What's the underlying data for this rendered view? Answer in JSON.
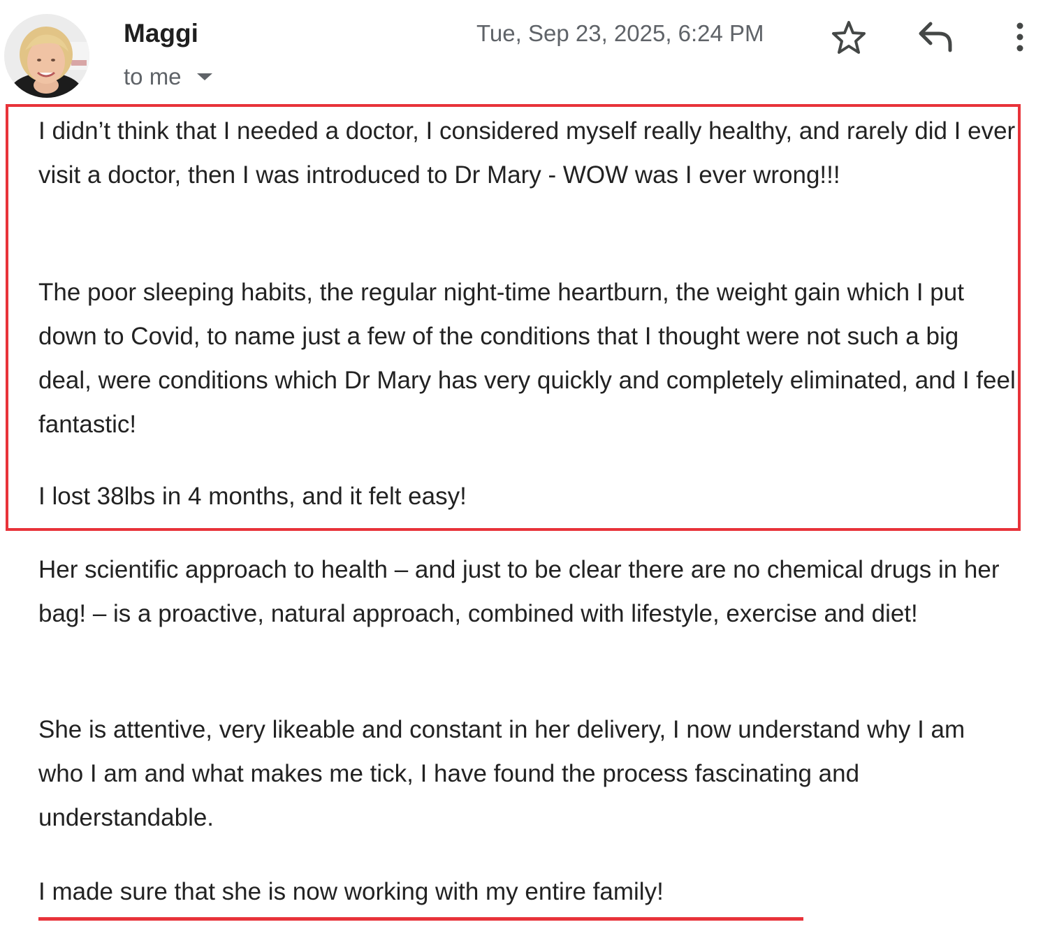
{
  "header": {
    "sender_name": "Maggi",
    "recipient_label": "to me",
    "timestamp": "Tue, Sep 23, 2025, 6:24 PM",
    "icons": {
      "star": "star-icon",
      "reply": "reply-icon",
      "more": "more-vertical-icon",
      "recipient_dropdown": "caret-down-icon"
    }
  },
  "message": {
    "paragraphs": [
      "I didn’t think that I needed a doctor, I considered myself really healthy, and rarely did I ever visit a doctor, then I was introduced to Dr Mary - WOW was I ever wrong!!!",
      "The poor sleeping habits, the regular night-time heartburn, the weight gain which I put down to Covid, to name just a few of the conditions that I thought were not such a big deal, were conditions which Dr Mary has very quickly and completely eliminated, and I feel fantastic!",
      "I lost 38lbs in 4 months, and it felt easy!",
      "Her scientific approach to health – and just to be clear there are no chemical drugs in her bag! – is a proactive, natural approach, combined with lifestyle, exercise and diet!",
      "She is attentive, very likeable and constant in her delivery, I now understand why I am who I am and what makes me tick, I have found the process fascinating and understandable.",
      "I made sure that she is now working with my entire family!"
    ]
  },
  "colors": {
    "highlight": "#e8333a",
    "text": "#222222",
    "muted": "#5f6368"
  }
}
